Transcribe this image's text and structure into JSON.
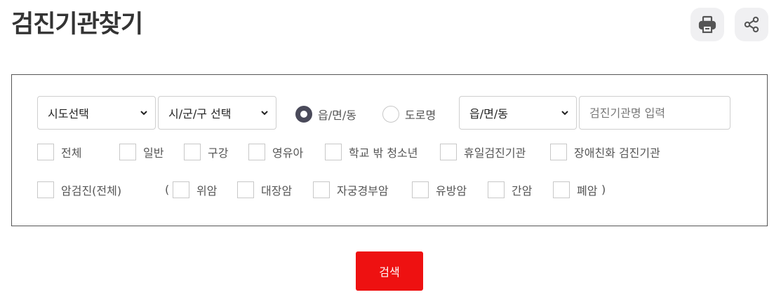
{
  "header": {
    "title": "검진기관찾기",
    "print_icon": "print-icon",
    "share_icon": "share-icon"
  },
  "filters": {
    "sido_select": "시도선택",
    "sigungu_select": "시/군/구 선택",
    "address_type": {
      "selected": "eup",
      "options": [
        {
          "id": "eup",
          "label": "읍/면/동"
        },
        {
          "id": "road",
          "label": "도로명"
        }
      ]
    },
    "dong_select": "읍/면/동",
    "name_placeholder": "검진기관명 입력",
    "checkbox_row1": [
      "전체",
      "일반",
      "구강",
      "영유아",
      "학교 밖 청소년",
      "휴일검진기관",
      "장애친화 검진기관"
    ],
    "cancer_all_label": "암검진(전체)",
    "open_paren": "(",
    "close_paren": ")",
    "cancer_types": [
      "위암",
      "대장암",
      "자궁경부암",
      "유방암",
      "간암",
      "폐암"
    ]
  },
  "search_button": "검색",
  "colors": {
    "accent_red": "#ee1111",
    "radio_selected": "#4a4a5a",
    "title": "#333333"
  }
}
